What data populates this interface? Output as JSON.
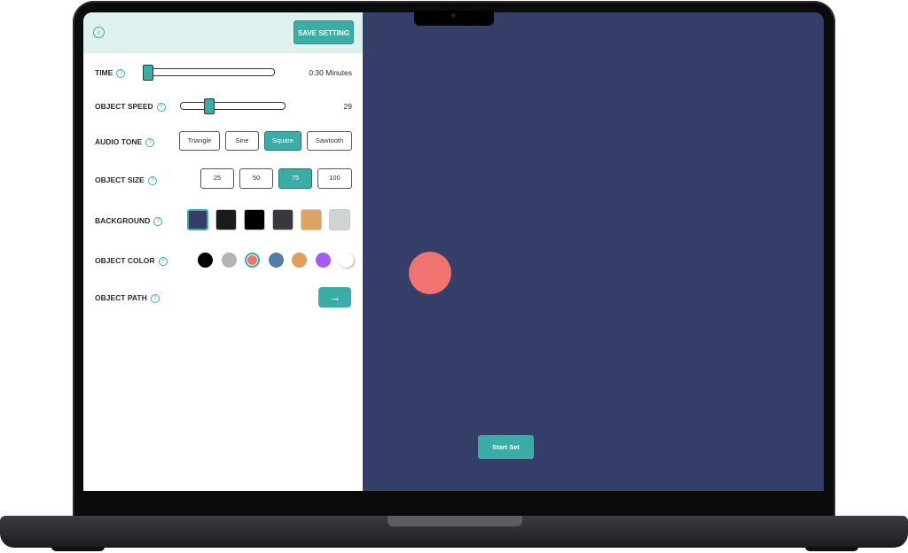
{
  "header": {
    "back_icon": "chevron-left-circle-icon",
    "save_label": "SAVE SETTING"
  },
  "settings": {
    "time": {
      "label": "TIME",
      "value_label": "0:30 Minutes",
      "slider_fraction": 0.0
    },
    "object_speed": {
      "label": "OBJECT SPEED",
      "value": "29",
      "slider_fraction": 0.25
    },
    "audio_tone": {
      "label": "AUDIO TONE",
      "options": [
        "Triangle",
        "Sine",
        "Square",
        "Sawtooth"
      ],
      "selected": "Square"
    },
    "object_size": {
      "label": "OBJECT SIZE",
      "options": [
        "25",
        "50",
        "75",
        "100"
      ],
      "selected": "75"
    },
    "background": {
      "label": "BACKGROUND",
      "swatches": [
        "#353e68",
        "#1a1a1a",
        "#000000",
        "#3a383d",
        "#e0a462",
        "#cfd4d3"
      ],
      "selected_index": 0
    },
    "object_color": {
      "label": "OBJECT COLOR",
      "colors": [
        "#000000",
        "#b3b3b3",
        "#f07370",
        "#4f7fa8",
        "#e0a05c",
        "#a35cf2",
        "#ffffff"
      ],
      "selected_index": 2
    },
    "object_path": {
      "label": "OBJECT PATH",
      "button_icon": "arrow-right-icon",
      "arrow": "→"
    }
  },
  "help_glyph": "?",
  "preview": {
    "object_color": "#f07370",
    "background": "#353e68",
    "start_label": "Start Set"
  },
  "colors": {
    "accent": "#3aaea6",
    "header_bg": "#dff1ef"
  }
}
